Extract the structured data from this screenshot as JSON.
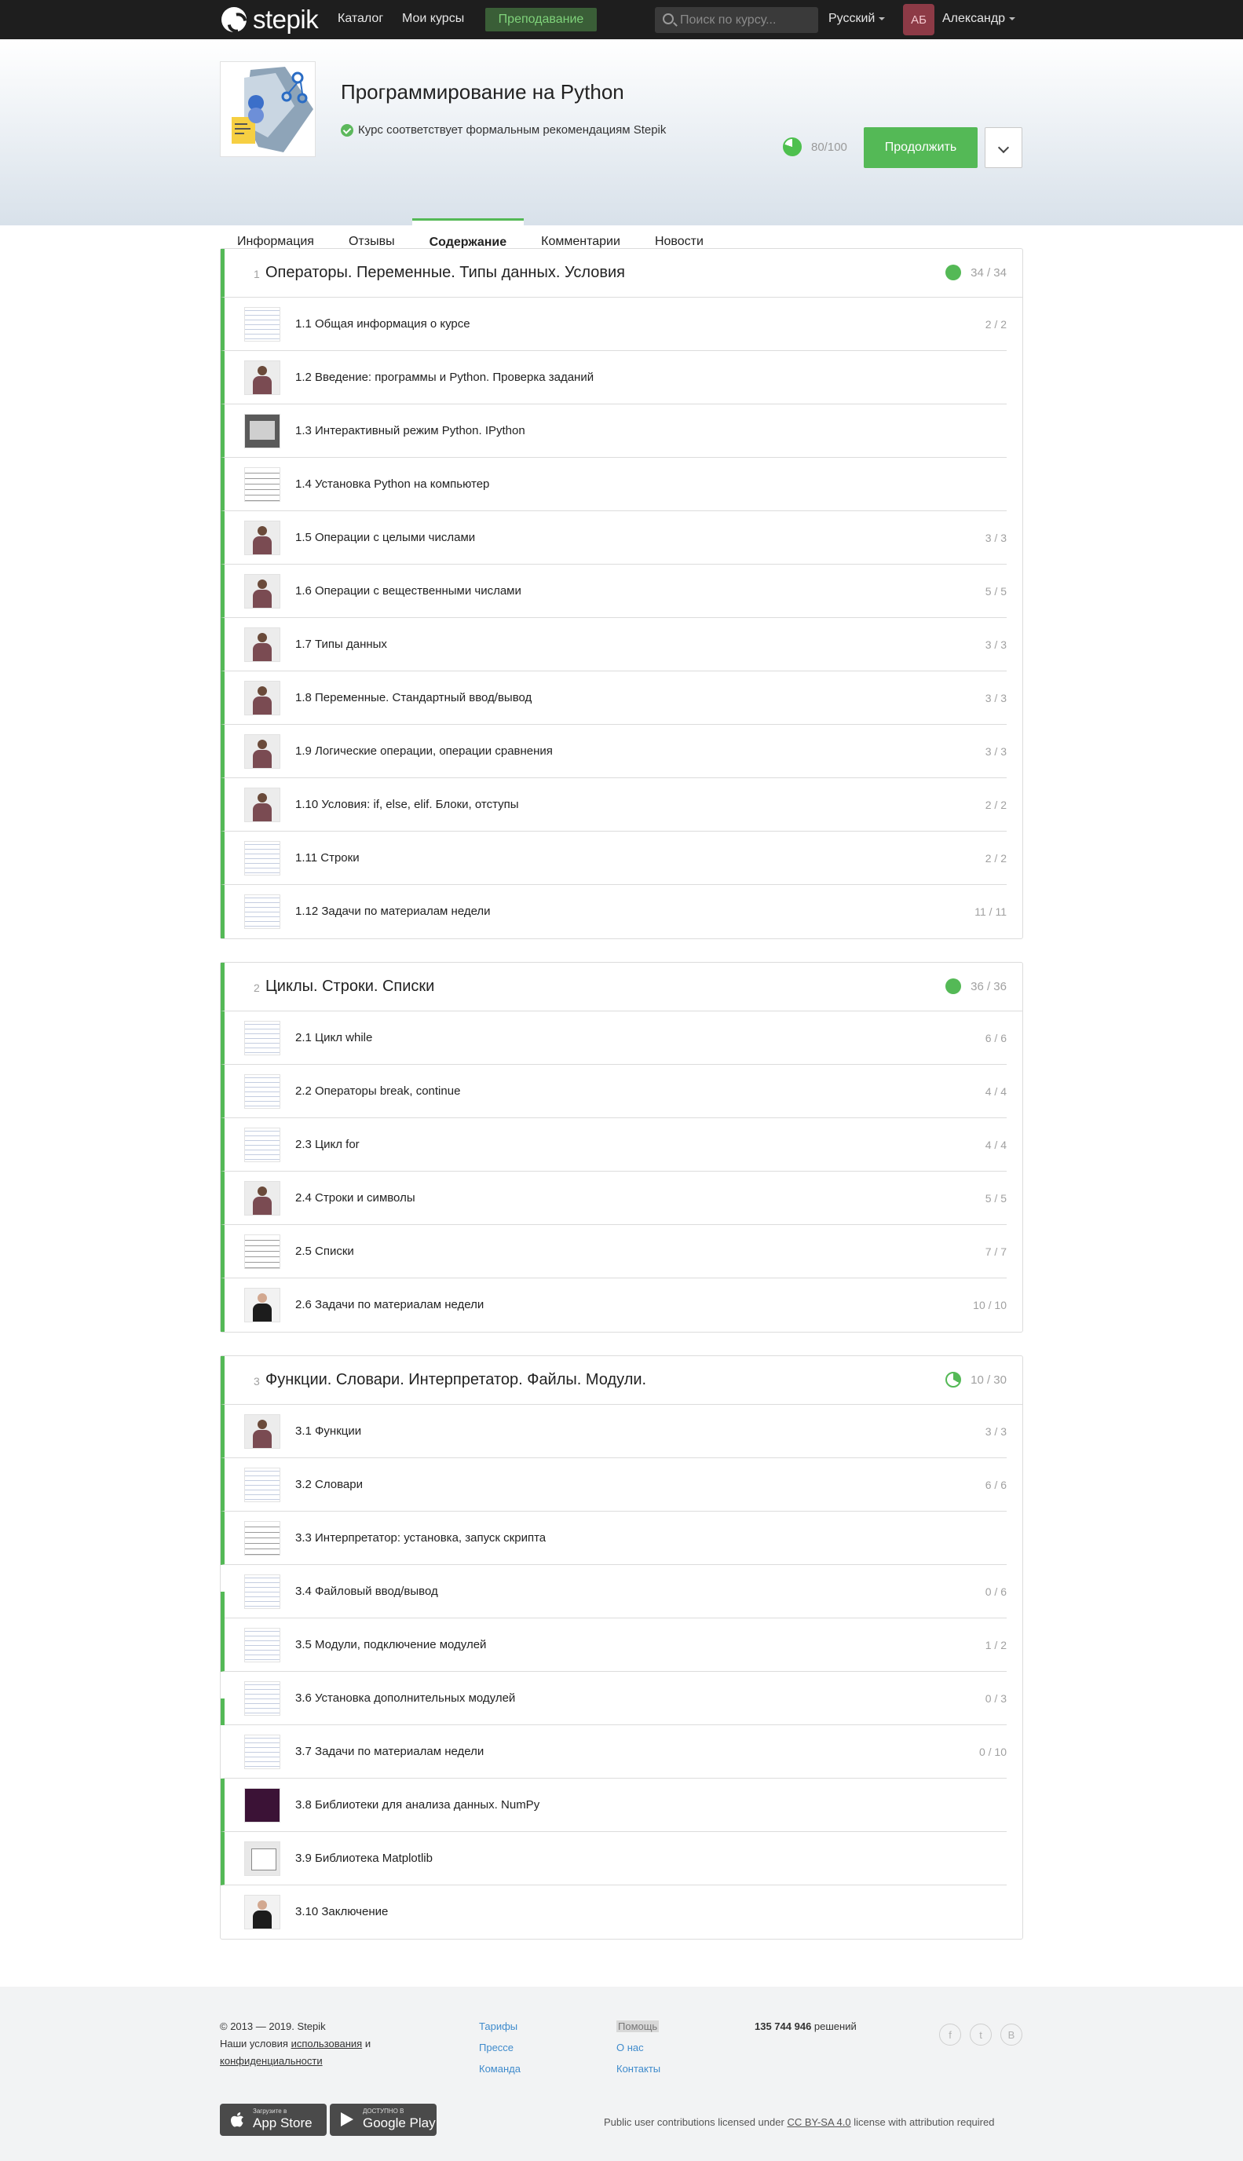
{
  "topbar": {
    "logo_text": "stepik",
    "nav": [
      "Каталог",
      "Мои курсы"
    ],
    "teach_label": "Преподавание",
    "search_placeholder": "Поиск по курсу...",
    "language": "Русский",
    "avatar_initials": "АБ",
    "username": "Александр",
    "colors": {
      "bar": "#1e1e1e",
      "teach_bg": "#3a5e37",
      "accent": "#54b956"
    }
  },
  "course": {
    "title": "Программирование на Python",
    "recommendation": "Курс соответствует формальным рекомендациям Stepik",
    "progress_text": "80/100",
    "progress_value": 0.8,
    "continue_label": "Продолжить"
  },
  "tabs": [
    "Информация",
    "Отзывы",
    "Содержание",
    "Комментарии",
    "Новости"
  ],
  "active_tab": "Содержание",
  "modules": [
    {
      "num": "1",
      "title": "Операторы. Переменные. Типы данных. Условия",
      "score": "34 / 34",
      "complete": true,
      "lessons": [
        {
          "title": "1.1 Общая информация о курсе",
          "score": "2 / 2",
          "thumb": "code",
          "state": "done"
        },
        {
          "title": "1.2 Введение: программы и Python. Проверка заданий",
          "score": "",
          "thumb": "person",
          "state": "done"
        },
        {
          "title": "1.3 Интерактивный режим Python. IPython",
          "score": "",
          "thumb": "gray",
          "state": "done"
        },
        {
          "title": "1.4 Установка Python на компьютер",
          "score": "",
          "thumb": "table",
          "state": "done"
        },
        {
          "title": "1.5 Операции с целыми числами",
          "score": "3 / 3",
          "thumb": "person",
          "state": "done"
        },
        {
          "title": "1.6 Операции с вещественными числами",
          "score": "5 / 5",
          "thumb": "person",
          "state": "done"
        },
        {
          "title": "1.7 Типы данных",
          "score": "3 / 3",
          "thumb": "person",
          "state": "done"
        },
        {
          "title": "1.8 Переменные. Стандартный ввод/вывод",
          "score": "3 / 3",
          "thumb": "person",
          "state": "done"
        },
        {
          "title": "1.9 Логические операции, операции сравнения",
          "score": "3 / 3",
          "thumb": "person",
          "state": "done"
        },
        {
          "title": "1.10 Условия: if, else, elif. Блоки, отступы",
          "score": "2 / 2",
          "thumb": "person",
          "state": "done"
        },
        {
          "title": "1.11 Строки",
          "score": "2 / 2",
          "thumb": "code",
          "state": "done"
        },
        {
          "title": "1.12 Задачи по материалам недели",
          "score": "11 / 11",
          "thumb": "code",
          "state": "done"
        }
      ]
    },
    {
      "num": "2",
      "title": "Циклы. Строки. Списки",
      "score": "36 / 36",
      "complete": true,
      "lessons": [
        {
          "title": "2.1 Цикл while",
          "score": "6 / 6",
          "thumb": "code",
          "state": "done"
        },
        {
          "title": "2.2 Операторы break, continue",
          "score": "4 / 4",
          "thumb": "code",
          "state": "done"
        },
        {
          "title": "2.3 Цикл for",
          "score": "4 / 4",
          "thumb": "code",
          "state": "done"
        },
        {
          "title": "2.4 Строки и символы",
          "score": "5 / 5",
          "thumb": "person",
          "state": "done"
        },
        {
          "title": "2.5 Списки",
          "score": "7 / 7",
          "thumb": "table",
          "state": "done"
        },
        {
          "title": "2.6 Задачи по материалам недели",
          "score": "10 / 10",
          "thumb": "black",
          "state": "done"
        }
      ]
    },
    {
      "num": "3",
      "title": "Функции. Словари. Интерпретатор. Файлы. Модули.",
      "score": "10 / 30",
      "complete": false,
      "lessons": [
        {
          "title": "3.1 Функции",
          "score": "3 / 3",
          "thumb": "person",
          "state": "done"
        },
        {
          "title": "3.2 Словари",
          "score": "6 / 6",
          "thumb": "code",
          "state": "done"
        },
        {
          "title": "3.3 Интерпретатор: установка, запуск скрипта",
          "score": "",
          "thumb": "table",
          "state": "done"
        },
        {
          "title": "3.4 Файловый ввод/вывод",
          "score": "0 / 6",
          "thumb": "code",
          "state": "half"
        },
        {
          "title": "3.5 Модули, подключение модулей",
          "score": "1 / 2",
          "thumb": "code",
          "state": "done"
        },
        {
          "title": "3.6 Установка дополнительных модулей",
          "score": "0 / 3",
          "thumb": "code",
          "state": "half"
        },
        {
          "title": "3.7 Задачи по материалам недели",
          "score": "0 / 10",
          "thumb": "code",
          "state": "none"
        },
        {
          "title": "3.8 Библиотеки для анализа данных. NumPy",
          "score": "",
          "thumb": "dark",
          "state": "done"
        },
        {
          "title": "3.9 Библиотека Matplotlib",
          "score": "",
          "thumb": "dialog",
          "state": "done"
        },
        {
          "title": "3.10 Заключение",
          "score": "",
          "thumb": "black",
          "state": "none"
        }
      ]
    }
  ],
  "footer": {
    "copyright": "© 2013 — 2019. Stepik",
    "terms_prefix": "Наши условия",
    "terms_link": "использования",
    "terms_and": "и",
    "privacy_link": "конфиденциальности",
    "col2": [
      "Тарифы",
      "Прессе",
      "Команда"
    ],
    "col3": [
      "Помощь",
      "О нас",
      "Контакты"
    ],
    "solutions_count": "135 744 946",
    "solutions_label": "решений",
    "social": [
      "f",
      "t",
      "В"
    ],
    "appstore_small": "Загрузите в",
    "appstore_big": "App Store",
    "gplay_small": "ДОСТУПНО В",
    "gplay_big": "Google Play",
    "license_prefix": "Public user contributions licensed under",
    "license_link": "CC BY-SA 4.0",
    "license_suffix": "license with attribution required"
  }
}
